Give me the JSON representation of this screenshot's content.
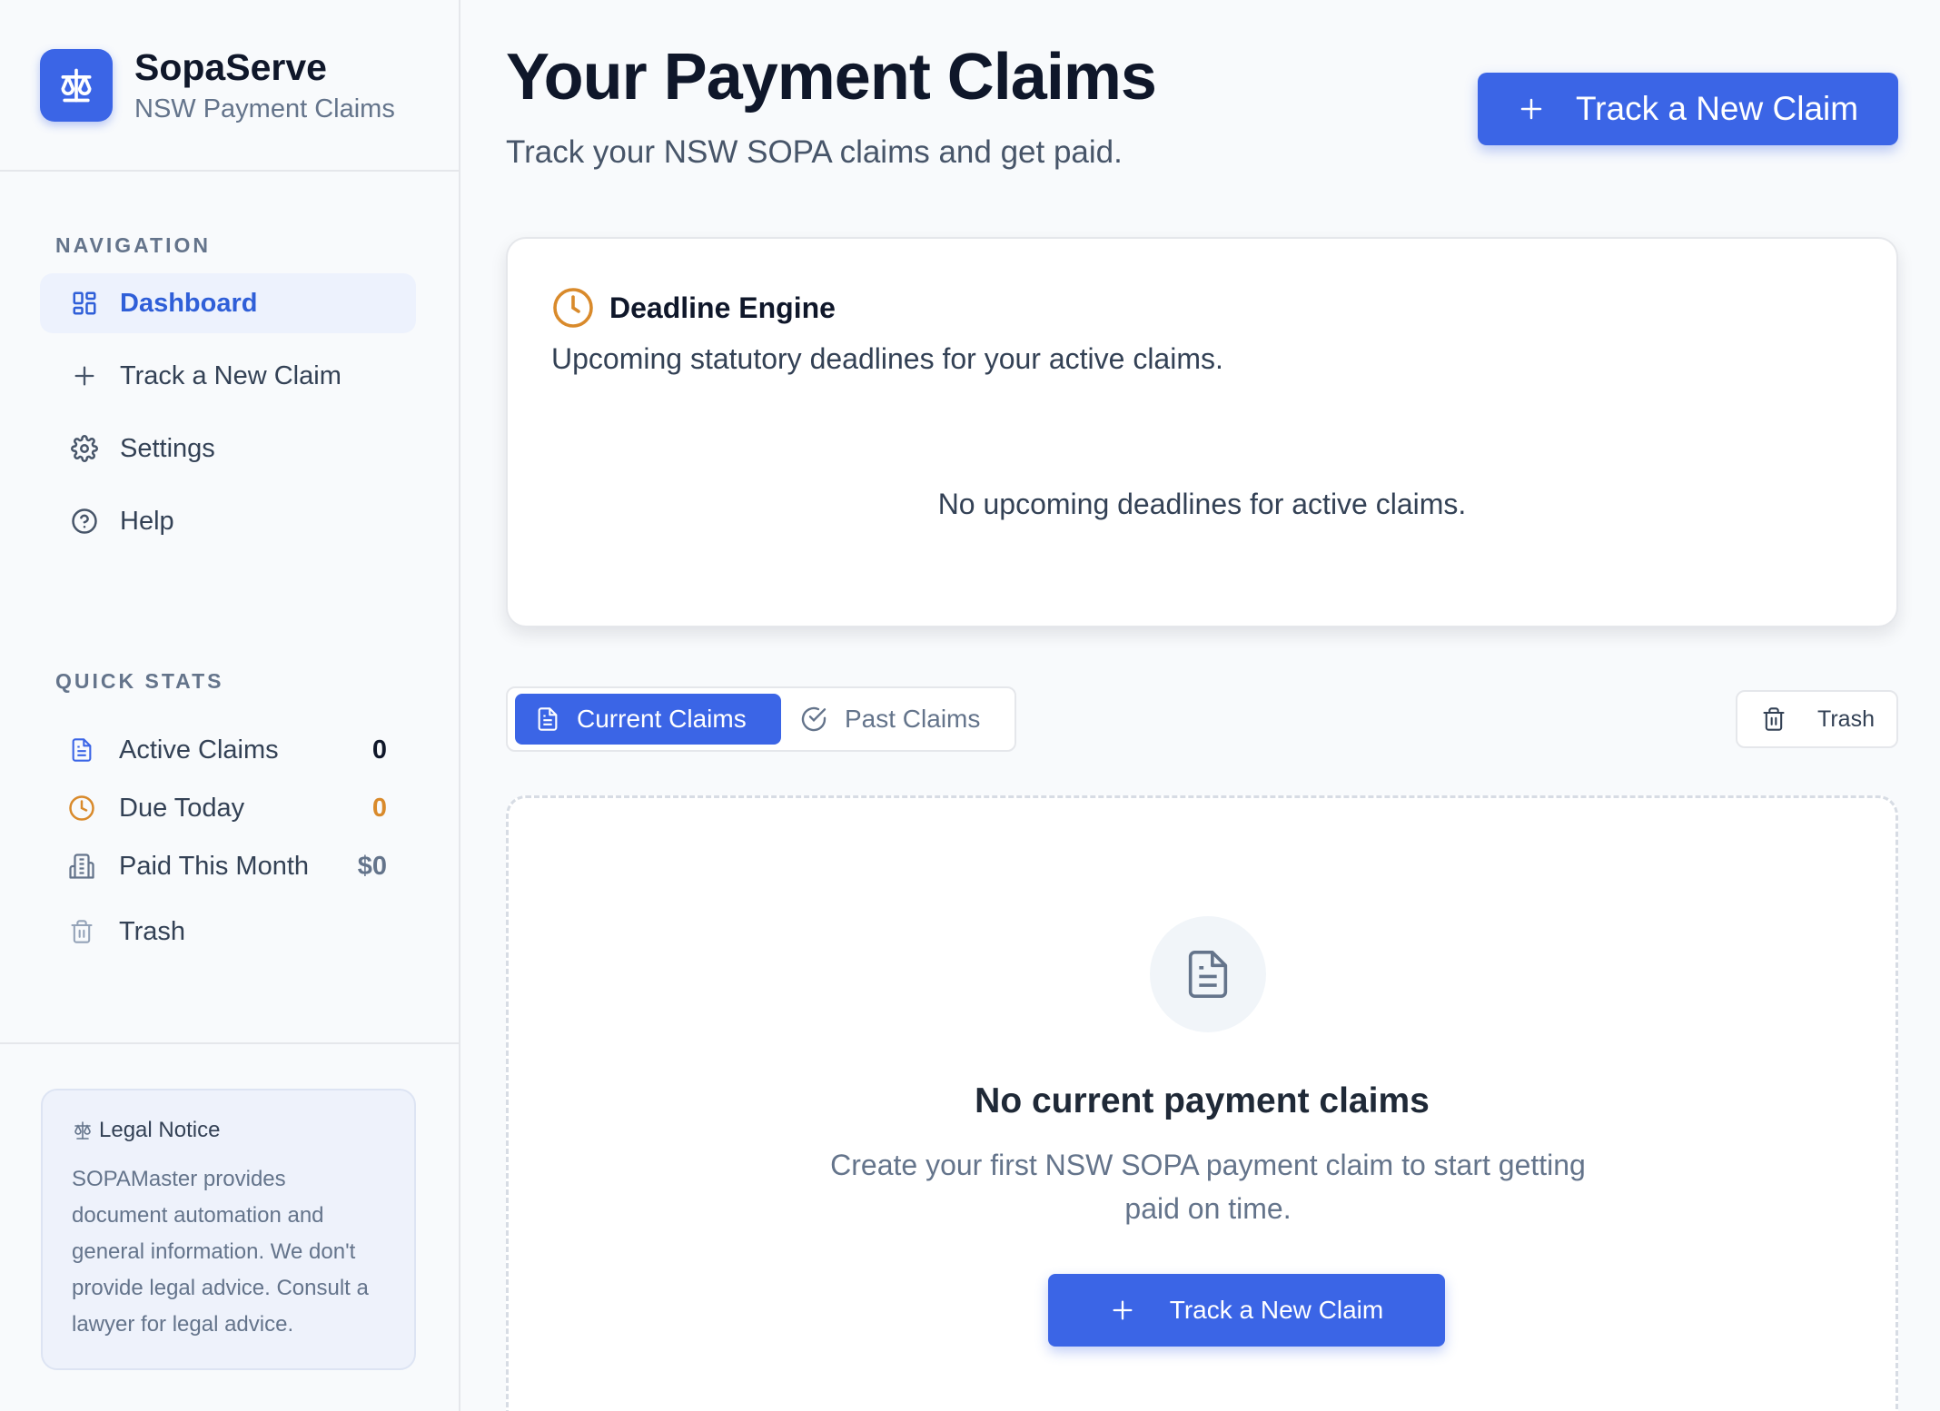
{
  "brand": {
    "name": "SopaServe",
    "subtitle": "NSW Payment Claims",
    "logo_icon": "scale-icon"
  },
  "sidebar": {
    "nav_label": "NAVIGATION",
    "nav_items": [
      {
        "label": "Dashboard",
        "icon": "dashboard-icon",
        "active": true
      },
      {
        "label": "Track a New Claim",
        "icon": "plus-icon",
        "active": false
      },
      {
        "label": "Settings",
        "icon": "gear-icon",
        "active": false
      },
      {
        "label": "Help",
        "icon": "help-circle-icon",
        "active": false
      }
    ],
    "stats_label": "QUICK STATS",
    "stats": [
      {
        "label": "Active Claims",
        "value": "0",
        "icon": "document-icon"
      },
      {
        "label": "Due Today",
        "value": "0",
        "icon": "clock-icon"
      },
      {
        "label": "Paid This Month",
        "value": "$0",
        "icon": "building-icon"
      },
      {
        "label": "Trash",
        "value": "",
        "icon": "trash-icon"
      }
    ],
    "legal": {
      "title": "Legal Notice",
      "body": "SOPAMaster provides document automation and general information. We don't provide legal advice. Consult a lawyer for legal advice."
    }
  },
  "header": {
    "title": "Your Payment Claims",
    "subtitle": "Track your NSW SOPA claims and get paid.",
    "primary_button": "Track a New Claim"
  },
  "deadline_card": {
    "title": "Deadline Engine",
    "description": "Upcoming statutory deadlines for your active claims.",
    "empty_text": "No upcoming deadlines for active claims."
  },
  "tabs": [
    {
      "label": "Current Claims",
      "active": true
    },
    {
      "label": "Past Claims",
      "active": false
    }
  ],
  "trash_button": "Trash",
  "empty_state": {
    "title": "No current payment claims",
    "description": "Create your first NSW SOPA payment claim to start getting paid on time.",
    "button": "Track a New Claim"
  },
  "colors": {
    "accent": "#3b65e6",
    "warning": "#d98a2b",
    "background": "#f8fafc"
  }
}
